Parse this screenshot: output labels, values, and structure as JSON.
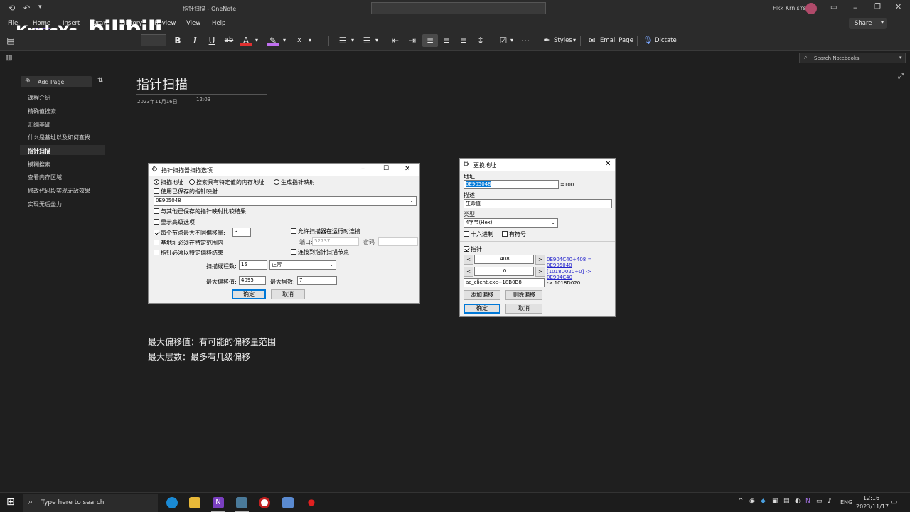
{
  "window": {
    "title": "指针扫描 - OneNote",
    "user": "Hkk KrnlsYs"
  },
  "watermark": {
    "left": "KrnlsYs",
    "right": "bilibili"
  },
  "menu": {
    "file": "File",
    "home": "Home",
    "insert": "Insert",
    "draw": "Draw",
    "history": "History",
    "review": "Review",
    "view": "View",
    "help": "Help",
    "share": "Share"
  },
  "ribbon": {
    "bold": "B",
    "italic": "I",
    "underline": "U",
    "strike": "ab",
    "styles": "Styles",
    "email_page": "Email Page",
    "dictate": "Dictate"
  },
  "search_notebooks": "Search Notebooks",
  "sidebar": {
    "add_page": "Add Page",
    "pages": [
      {
        "label": "课程介绍"
      },
      {
        "label": "精确值搜索"
      },
      {
        "label": "汇编基础"
      },
      {
        "label": "什么是基址以及如何查找"
      },
      {
        "label": "指针扫描"
      },
      {
        "label": "模糊搜索"
      },
      {
        "label": "查看内存区域"
      },
      {
        "label": "修改代码段实现无敌效果"
      },
      {
        "label": "实现无后坐力"
      }
    ]
  },
  "page": {
    "title": "指针扫描",
    "date": "2023年11月16日",
    "time": "12:03",
    "note_line1": "最大偏移值：有可能的偏移量范围",
    "note_line2": "最大层数：最多有几级偏移"
  },
  "scan_dialog": {
    "title": "指针扫描器扫描选项",
    "radio_scan_address": "扫描地址",
    "radio_search_value": "搜索具有特定值的内存地址",
    "radio_generate_map": "生成指针映射",
    "chk_use_saved_map": "使用已保存的指针映射",
    "address_value": "0E905048",
    "chk_compare_results": "与其他已保存的指针映射比较结果",
    "chk_advanced": "显示高级选项",
    "chk_max_offsets": "每个节点最大不同偏移量:",
    "max_offsets_value": "3",
    "chk_base_in_range": "基地址必须在特定范围内",
    "chk_pointer_ends": "指针必须以特定偏移结束",
    "chk_allow_connect": "允许扫描器在运行时连接",
    "port_label": "端口:",
    "port_value": "52737",
    "password_label": "密码",
    "chk_connect_node": "连接到指针扫描节点",
    "threads_label": "扫描线程数:",
    "threads_value": "15",
    "priority_value": "正常",
    "max_offset_label": "最大偏移值:",
    "max_offset_value": "4095",
    "max_level_label": "最大层数:",
    "max_level_value": "7",
    "ok": "确定",
    "cancel": "取消"
  },
  "change_dialog": {
    "title": "更换地址",
    "address_label": "地址:",
    "address_value": "0E905048",
    "address_result": "=100",
    "desc_label": "描述",
    "desc_value": "生命值",
    "type_label": "类型",
    "type_value": "4字节(Hex)",
    "chk_hex": "十六进制",
    "chk_signed": "有符号",
    "chk_pointer": "指针",
    "offset1": "408",
    "offset1_link": "0E904C40+408 = 0E905048",
    "offset2": "0",
    "offset2_link": "[1018D020+0] -> 0E904C40",
    "base_value": "ac_client.exe+18B0B8",
    "base_result": "-> 1018D020",
    "add_offset": "添加偏移",
    "delete_offset": "删除偏移",
    "ok": "确定",
    "cancel": "取消"
  },
  "taskbar": {
    "search": "Type here to search",
    "lang": "ENG",
    "time": "12:16",
    "date": "2023/11/17"
  }
}
